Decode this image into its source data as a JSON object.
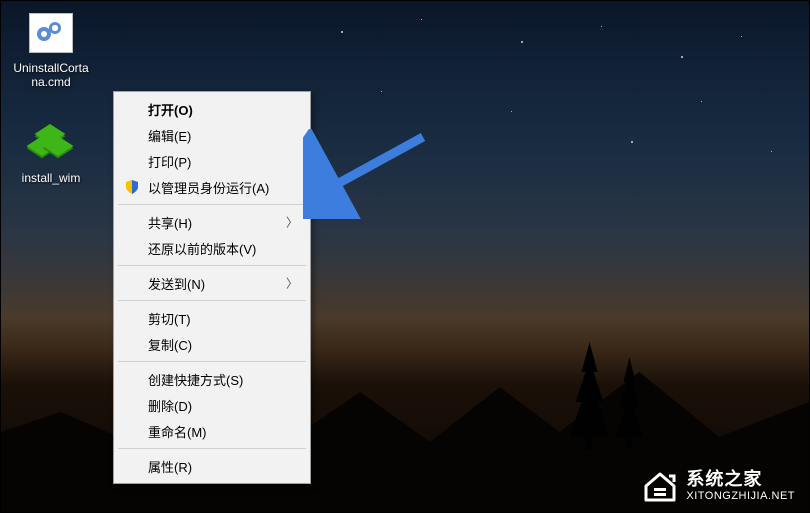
{
  "desktop": {
    "icons": [
      {
        "label": "UninstallCortana.cmd",
        "type": "cmd"
      },
      {
        "label": "install_wim",
        "type": "wim"
      }
    ]
  },
  "context_menu": {
    "groups": [
      [
        {
          "id": "open",
          "label": "打开(O)",
          "bold": true
        },
        {
          "id": "edit",
          "label": "编辑(E)"
        },
        {
          "id": "print",
          "label": "打印(P)"
        },
        {
          "id": "run-as-admin",
          "label": "以管理员身份运行(A)",
          "icon": "shield"
        }
      ],
      [
        {
          "id": "share",
          "label": "共享(H)",
          "submenu": true
        },
        {
          "id": "restore-versions",
          "label": "还原以前的版本(V)"
        }
      ],
      [
        {
          "id": "send-to",
          "label": "发送到(N)",
          "submenu": true
        }
      ],
      [
        {
          "id": "cut",
          "label": "剪切(T)"
        },
        {
          "id": "copy",
          "label": "复制(C)"
        }
      ],
      [
        {
          "id": "create-shortcut",
          "label": "创建快捷方式(S)"
        },
        {
          "id": "delete",
          "label": "删除(D)"
        },
        {
          "id": "rename",
          "label": "重命名(M)"
        }
      ],
      [
        {
          "id": "properties",
          "label": "属性(R)"
        }
      ]
    ]
  },
  "annotation": {
    "target": "run-as-admin",
    "color": "#3d7dde"
  },
  "watermark": {
    "cn": "系统之家",
    "en": "XITONGZHIJIA.NET"
  }
}
